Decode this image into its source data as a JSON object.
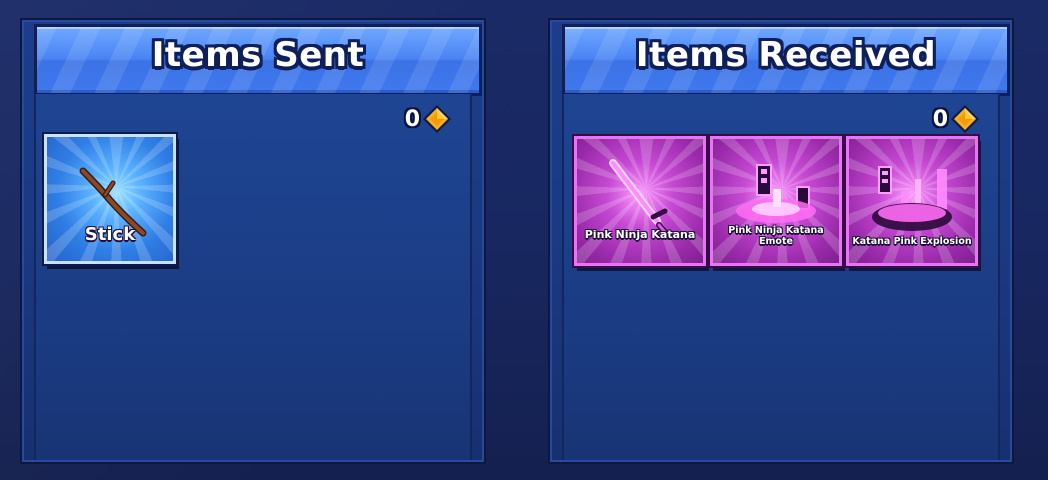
{
  "sent": {
    "title": "Items Sent",
    "gem_count": "0",
    "items": [
      {
        "name": "Stick",
        "rarity_color": "#2f7fe6",
        "icon": "stick-icon"
      }
    ]
  },
  "received": {
    "title": "Items Received",
    "gem_count": "0",
    "items": [
      {
        "name": "Pink Ninja Katana",
        "rarity_color": "#b23dc2",
        "icon": "katana-icon"
      },
      {
        "name": "Pink Ninja Katana Emote",
        "rarity_color": "#b23dc2",
        "icon": "emote-icon"
      },
      {
        "name": "Katana Pink Explosion",
        "rarity_color": "#b23dc2",
        "icon": "explosion-icon"
      }
    ]
  },
  "currency_icon": "gem-icon",
  "colors": {
    "header_blue": "#4a84f3",
    "panel_blue": "#1c3a83",
    "gem_gold": "#f7b21a",
    "pink_rarity": "#b23dc2"
  }
}
